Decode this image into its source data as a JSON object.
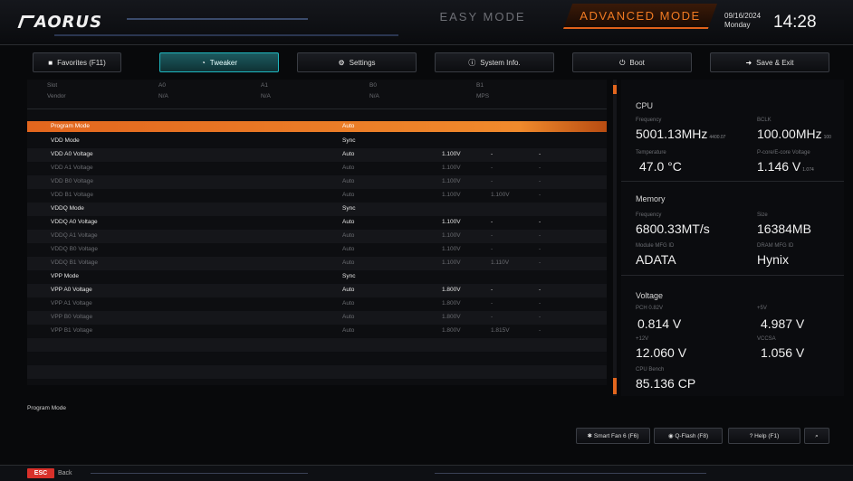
{
  "header": {
    "logo": "AORUS",
    "mode_easy": "EASY MODE",
    "mode_advanced": "ADVANCED MODE",
    "date": "09/16/2024",
    "weekday": "Monday",
    "time": "14:28"
  },
  "tabs": [
    {
      "label": "Favorites (F11)",
      "icon": "favorites-icon"
    },
    {
      "label": "Tweaker",
      "icon": "tweaker-icon"
    },
    {
      "label": "Settings",
      "icon": "settings-icon"
    },
    {
      "label": "System Info.",
      "icon": "info-icon"
    },
    {
      "label": "Boot",
      "icon": "power-icon"
    },
    {
      "label": "Save & Exit",
      "icon": "exit-icon"
    }
  ],
  "table_header": {
    "slot": [
      "Slot",
      "A0",
      "A1",
      "B0",
      "B1"
    ],
    "vendor": [
      "Vendor",
      "N/A",
      "N/A",
      "N/A",
      "MPS"
    ]
  },
  "rows": [
    {
      "name": "Program Mode",
      "value": "Auto",
      "volt": "",
      "extra": "",
      "style": "sel"
    },
    {
      "name": "VDD Mode",
      "value": "Sync",
      "volt": "",
      "extra": "",
      "style": "bold"
    },
    {
      "name": "VDD A0 Voltage",
      "value": "Auto",
      "volt": "1.100V",
      "extra": "-",
      "style": "bold"
    },
    {
      "name": "VDD A1 Voltage",
      "value": "Auto",
      "volt": "1.100V",
      "extra": "-",
      "style": "dim"
    },
    {
      "name": "VDD B0 Voltage",
      "value": "Auto",
      "volt": "1.100V",
      "extra": "-",
      "style": "dim"
    },
    {
      "name": "VDD B1 Voltage",
      "value": "Auto",
      "volt": "1.100V",
      "extra": "1.100V",
      "style": "dim"
    },
    {
      "name": "VDDQ Mode",
      "value": "Sync",
      "volt": "",
      "extra": "",
      "style": "bold"
    },
    {
      "name": "VDDQ A0 Voltage",
      "value": "Auto",
      "volt": "1.100V",
      "extra": "-",
      "style": "bold"
    },
    {
      "name": "VDDQ A1 Voltage",
      "value": "Auto",
      "volt": "1.100V",
      "extra": "-",
      "style": "dim"
    },
    {
      "name": "VDDQ B0 Voltage",
      "value": "Auto",
      "volt": "1.100V",
      "extra": "-",
      "style": "dim"
    },
    {
      "name": "VDDQ B1 Voltage",
      "value": "Auto",
      "volt": "1.100V",
      "extra": "1.110V",
      "style": "dim"
    },
    {
      "name": "VPP Mode",
      "value": "Sync",
      "volt": "",
      "extra": "",
      "style": "bold"
    },
    {
      "name": "VPP A0 Voltage",
      "value": "Auto",
      "volt": "1.800V",
      "extra": "-",
      "style": "bold"
    },
    {
      "name": "VPP A1 Voltage",
      "value": "Auto",
      "volt": "1.800V",
      "extra": "-",
      "style": "dim"
    },
    {
      "name": "VPP B0 Voltage",
      "value": "Auto",
      "volt": "1.800V",
      "extra": "-",
      "style": "dim"
    },
    {
      "name": "VPP B1 Voltage",
      "value": "Auto",
      "volt": "1.800V",
      "extra": "1.815V",
      "style": "dim"
    }
  ],
  "sidebar": {
    "cpu": {
      "title": "CPU",
      "freq_label": "Frequency",
      "freq_value": "5001.13MHz",
      "freq_sub": "4400.07",
      "bclk_label": "BCLK",
      "bclk_value": "100.00MHz",
      "bclk_sub": "100",
      "temp_label": "Temperature",
      "temp_value": "47.0 °C",
      "vcore_label": "P-core/E-core Voltage",
      "vcore_value": "1.146 V",
      "vcore_sub": "1.074"
    },
    "memory": {
      "title": "Memory",
      "freq_label": "Frequency",
      "freq_value": "6800.33MT/s",
      "size_label": "Size",
      "size_value": "16384MB",
      "mfg_label": "Module MFG ID",
      "mfg_value": "ADATA",
      "dram_label": "DRAM MFG ID",
      "dram_value": "Hynix"
    },
    "voltage": {
      "title": "Voltage",
      "pch_label": "PCH 0.82V",
      "pch_value": "0.814 V",
      "v5_label": "+5V",
      "v5_value": "4.987 V",
      "v12_label": "+12V",
      "v12_value": "12.060 V",
      "vccsa_label": "VCCSA",
      "vccsa_value": "1.056 V",
      "bench_label": "CPU Bench",
      "bench_value": "85.136 CP"
    }
  },
  "help_text": "Program Mode",
  "bottom_buttons": [
    {
      "label": "Smart Fan 6 (F6)",
      "icon": "fan-icon"
    },
    {
      "label": "Q-Flash (F8)",
      "icon": "qflash-icon"
    },
    {
      "label": "Help (F1)",
      "icon": "help-icon"
    },
    {
      "label": "",
      "icon": "search-icon"
    }
  ],
  "footer": {
    "esc": "ESC",
    "back": "Back"
  },
  "colors": {
    "accent_orange": "#e2661e",
    "tweaker_teal": "#1fb7c0",
    "esc_red": "#d8302a"
  }
}
